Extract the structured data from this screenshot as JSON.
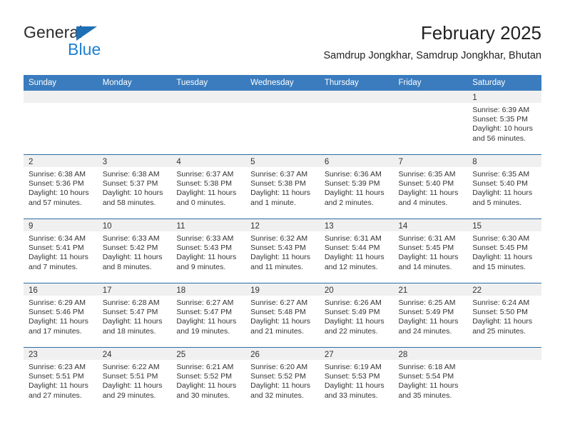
{
  "brand": {
    "name_part1": "General",
    "name_part2": "Blue",
    "triangle_icon": "triangle-icon",
    "color_dark": "#2b2b2b",
    "color_blue": "#1f7fd0",
    "color_triangle": "#1f6fb5"
  },
  "header": {
    "title": "February 2025",
    "subtitle": "Samdrup Jongkhar, Samdrup Jongkhar, Bhutan",
    "accent_color": "#3a7cbe",
    "row_divider_color": "#2e6da4"
  },
  "calendar": {
    "weekday_headers": [
      "Sunday",
      "Monday",
      "Tuesday",
      "Wednesday",
      "Thursday",
      "Friday",
      "Saturday"
    ],
    "weeks": [
      [
        {
          "empty": true
        },
        {
          "empty": true
        },
        {
          "empty": true
        },
        {
          "empty": true
        },
        {
          "empty": true
        },
        {
          "empty": true
        },
        {
          "day": "1",
          "sunrise": "Sunrise: 6:39 AM",
          "sunset": "Sunset: 5:35 PM",
          "daylight": "Daylight: 10 hours and 56 minutes."
        }
      ],
      [
        {
          "day": "2",
          "sunrise": "Sunrise: 6:38 AM",
          "sunset": "Sunset: 5:36 PM",
          "daylight": "Daylight: 10 hours and 57 minutes."
        },
        {
          "day": "3",
          "sunrise": "Sunrise: 6:38 AM",
          "sunset": "Sunset: 5:37 PM",
          "daylight": "Daylight: 10 hours and 58 minutes."
        },
        {
          "day": "4",
          "sunrise": "Sunrise: 6:37 AM",
          "sunset": "Sunset: 5:38 PM",
          "daylight": "Daylight: 11 hours and 0 minutes."
        },
        {
          "day": "5",
          "sunrise": "Sunrise: 6:37 AM",
          "sunset": "Sunset: 5:38 PM",
          "daylight": "Daylight: 11 hours and 1 minute."
        },
        {
          "day": "6",
          "sunrise": "Sunrise: 6:36 AM",
          "sunset": "Sunset: 5:39 PM",
          "daylight": "Daylight: 11 hours and 2 minutes."
        },
        {
          "day": "7",
          "sunrise": "Sunrise: 6:35 AM",
          "sunset": "Sunset: 5:40 PM",
          "daylight": "Daylight: 11 hours and 4 minutes."
        },
        {
          "day": "8",
          "sunrise": "Sunrise: 6:35 AM",
          "sunset": "Sunset: 5:40 PM",
          "daylight": "Daylight: 11 hours and 5 minutes."
        }
      ],
      [
        {
          "day": "9",
          "sunrise": "Sunrise: 6:34 AM",
          "sunset": "Sunset: 5:41 PM",
          "daylight": "Daylight: 11 hours and 7 minutes."
        },
        {
          "day": "10",
          "sunrise": "Sunrise: 6:33 AM",
          "sunset": "Sunset: 5:42 PM",
          "daylight": "Daylight: 11 hours and 8 minutes."
        },
        {
          "day": "11",
          "sunrise": "Sunrise: 6:33 AM",
          "sunset": "Sunset: 5:43 PM",
          "daylight": "Daylight: 11 hours and 9 minutes."
        },
        {
          "day": "12",
          "sunrise": "Sunrise: 6:32 AM",
          "sunset": "Sunset: 5:43 PM",
          "daylight": "Daylight: 11 hours and 11 minutes."
        },
        {
          "day": "13",
          "sunrise": "Sunrise: 6:31 AM",
          "sunset": "Sunset: 5:44 PM",
          "daylight": "Daylight: 11 hours and 12 minutes."
        },
        {
          "day": "14",
          "sunrise": "Sunrise: 6:31 AM",
          "sunset": "Sunset: 5:45 PM",
          "daylight": "Daylight: 11 hours and 14 minutes."
        },
        {
          "day": "15",
          "sunrise": "Sunrise: 6:30 AM",
          "sunset": "Sunset: 5:45 PM",
          "daylight": "Daylight: 11 hours and 15 minutes."
        }
      ],
      [
        {
          "day": "16",
          "sunrise": "Sunrise: 6:29 AM",
          "sunset": "Sunset: 5:46 PM",
          "daylight": "Daylight: 11 hours and 17 minutes."
        },
        {
          "day": "17",
          "sunrise": "Sunrise: 6:28 AM",
          "sunset": "Sunset: 5:47 PM",
          "daylight": "Daylight: 11 hours and 18 minutes."
        },
        {
          "day": "18",
          "sunrise": "Sunrise: 6:27 AM",
          "sunset": "Sunset: 5:47 PM",
          "daylight": "Daylight: 11 hours and 19 minutes."
        },
        {
          "day": "19",
          "sunrise": "Sunrise: 6:27 AM",
          "sunset": "Sunset: 5:48 PM",
          "daylight": "Daylight: 11 hours and 21 minutes."
        },
        {
          "day": "20",
          "sunrise": "Sunrise: 6:26 AM",
          "sunset": "Sunset: 5:49 PM",
          "daylight": "Daylight: 11 hours and 22 minutes."
        },
        {
          "day": "21",
          "sunrise": "Sunrise: 6:25 AM",
          "sunset": "Sunset: 5:49 PM",
          "daylight": "Daylight: 11 hours and 24 minutes."
        },
        {
          "day": "22",
          "sunrise": "Sunrise: 6:24 AM",
          "sunset": "Sunset: 5:50 PM",
          "daylight": "Daylight: 11 hours and 25 minutes."
        }
      ],
      [
        {
          "day": "23",
          "sunrise": "Sunrise: 6:23 AM",
          "sunset": "Sunset: 5:51 PM",
          "daylight": "Daylight: 11 hours and 27 minutes."
        },
        {
          "day": "24",
          "sunrise": "Sunrise: 6:22 AM",
          "sunset": "Sunset: 5:51 PM",
          "daylight": "Daylight: 11 hours and 29 minutes."
        },
        {
          "day": "25",
          "sunrise": "Sunrise: 6:21 AM",
          "sunset": "Sunset: 5:52 PM",
          "daylight": "Daylight: 11 hours and 30 minutes."
        },
        {
          "day": "26",
          "sunrise": "Sunrise: 6:20 AM",
          "sunset": "Sunset: 5:52 PM",
          "daylight": "Daylight: 11 hours and 32 minutes."
        },
        {
          "day": "27",
          "sunrise": "Sunrise: 6:19 AM",
          "sunset": "Sunset: 5:53 PM",
          "daylight": "Daylight: 11 hours and 33 minutes."
        },
        {
          "day": "28",
          "sunrise": "Sunrise: 6:18 AM",
          "sunset": "Sunset: 5:54 PM",
          "daylight": "Daylight: 11 hours and 35 minutes."
        },
        {
          "empty": true
        }
      ]
    ]
  }
}
